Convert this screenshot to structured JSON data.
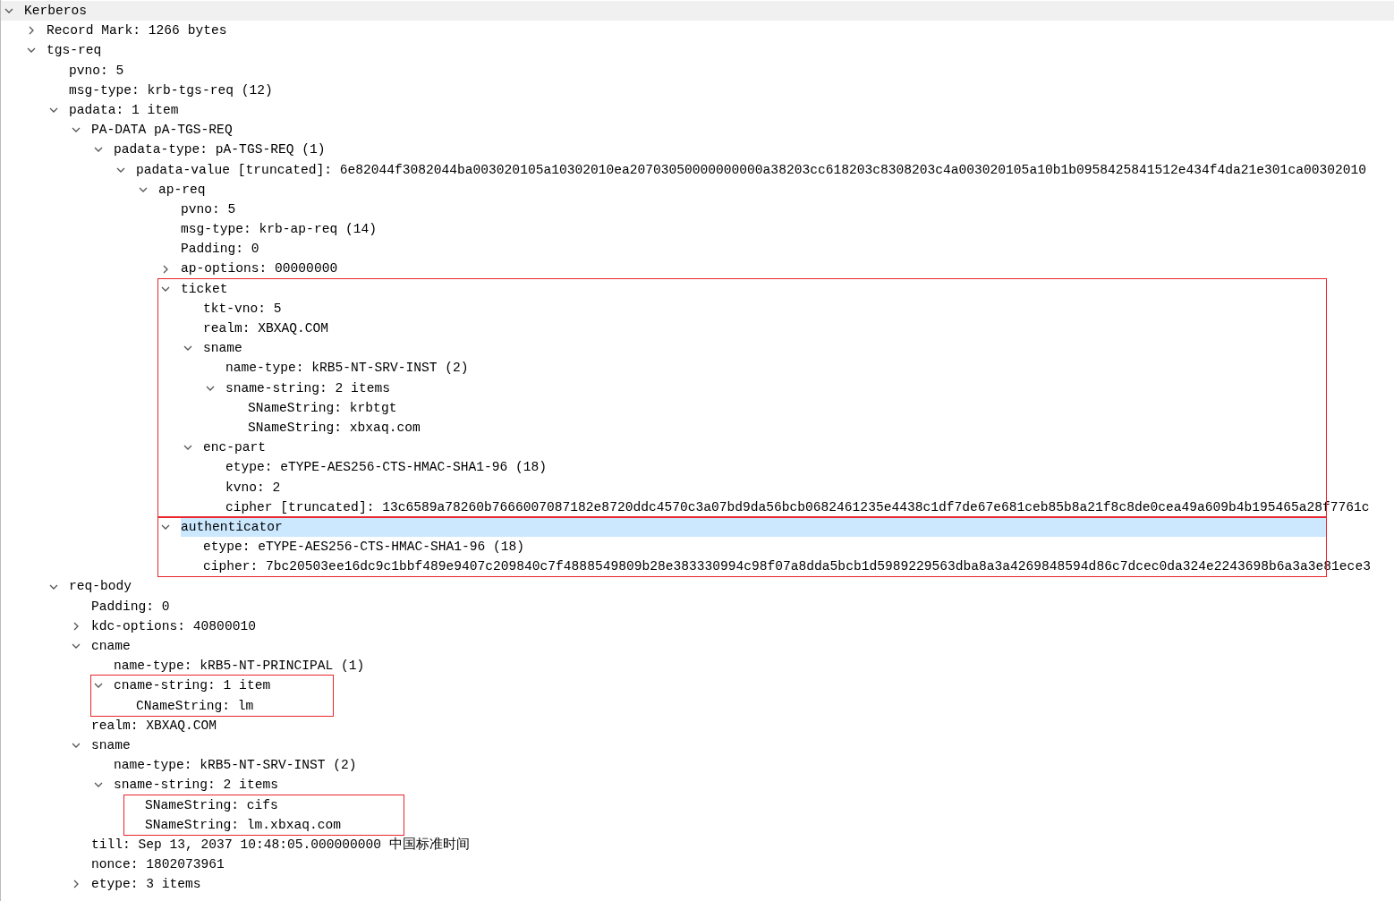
{
  "tree": [
    {
      "label": "Kerberos",
      "expanded": true,
      "selected": false,
      "children": [
        {
          "label": "Record Mark: 1266 bytes",
          "expanded": false,
          "selected": false
        },
        {
          "label": "tgs-req",
          "expanded": true,
          "selected": false,
          "children": [
            {
              "label": "pvno: 5",
              "selected": false
            },
            {
              "label": "msg-type: krb-tgs-req (12)",
              "selected": false
            },
            {
              "label": "padata: 1 item",
              "expanded": true,
              "selected": false,
              "children": [
                {
                  "label": "PA-DATA pA-TGS-REQ",
                  "expanded": true,
                  "selected": false,
                  "children": [
                    {
                      "label": "padata-type: pA-TGS-REQ (1)",
                      "expanded": true,
                      "selected": false,
                      "children": [
                        {
                          "label": "padata-value [truncated]: 6e82044f3082044ba003020105a10302010ea20703050000000000a38203cc618203c8308203c4a003020105a10b1b0958425841512e434f4da21e301ca00302010",
                          "expanded": true,
                          "selected": false,
                          "children": [
                            {
                              "label": "ap-req",
                              "expanded": true,
                              "selected": false,
                              "children": [
                                {
                                  "label": "pvno: 5",
                                  "selected": false
                                },
                                {
                                  "label": "msg-type: krb-ap-req (14)",
                                  "selected": false
                                },
                                {
                                  "label": "Padding: 0",
                                  "selected": false
                                },
                                {
                                  "label": "ap-options: 00000000",
                                  "expanded": false,
                                  "selected": false
                                },
                                {
                                  "label": "ticket",
                                  "expanded": true,
                                  "selected": false,
                                  "annotated": true,
                                  "children": [
                                    {
                                      "label": "tkt-vno: 5",
                                      "selected": false
                                    },
                                    {
                                      "label": "realm: XBXAQ.COM",
                                      "selected": false
                                    },
                                    {
                                      "label": "sname",
                                      "expanded": true,
                                      "selected": false,
                                      "children": [
                                        {
                                          "label": "name-type: kRB5-NT-SRV-INST (2)",
                                          "selected": false
                                        },
                                        {
                                          "label": "sname-string: 2 items",
                                          "expanded": true,
                                          "selected": false,
                                          "children": [
                                            {
                                              "label": "SNameString: krbtgt",
                                              "selected": false
                                            },
                                            {
                                              "label": "SNameString: xbxaq.com",
                                              "selected": false
                                            }
                                          ]
                                        }
                                      ]
                                    },
                                    {
                                      "label": "enc-part",
                                      "expanded": true,
                                      "selected": false,
                                      "children": [
                                        {
                                          "label": "etype: eTYPE-AES256-CTS-HMAC-SHA1-96 (18)",
                                          "selected": false
                                        },
                                        {
                                          "label": "kvno: 2",
                                          "selected": false
                                        },
                                        {
                                          "label": "cipher [truncated]: 13c6589a78260b7666007087182e8720ddc4570c3a07bd9da56bcb0682461235e4438c1df7de67e681ceb85b8a21f8c8de0cea49a609b4b195465a28f7761c",
                                          "selected": false
                                        }
                                      ]
                                    }
                                  ]
                                },
                                {
                                  "label": "authenticator",
                                  "expanded": true,
                                  "selected": true,
                                  "annotated": true,
                                  "children": [
                                    {
                                      "label": "etype: eTYPE-AES256-CTS-HMAC-SHA1-96 (18)",
                                      "selected": false
                                    },
                                    {
                                      "label": "cipher: 7bc20503ee16dc9c1bbf489e9407c209840c7f4888549809b28e383330994c98f07a8dda5bcb1d5989229563dba8a3a4269848594d86c7dcec0da324e2243698b6a3a3e81ece3",
                                      "selected": false
                                    }
                                  ]
                                }
                              ]
                            }
                          ]
                        }
                      ]
                    }
                  ]
                }
              ]
            },
            {
              "label": "req-body",
              "expanded": true,
              "selected": false,
              "children": [
                {
                  "label": "Padding: 0",
                  "selected": false
                },
                {
                  "label": "kdc-options: 40800010",
                  "expanded": false,
                  "selected": false
                },
                {
                  "label": "cname",
                  "expanded": true,
                  "selected": false,
                  "children": [
                    {
                      "label": "name-type: kRB5-NT-PRINCIPAL (1)",
                      "selected": false
                    },
                    {
                      "label": "cname-string: 1 item",
                      "expanded": true,
                      "selected": false,
                      "annotated": true,
                      "children": [
                        {
                          "label": "CNameString: lm",
                          "selected": false
                        }
                      ]
                    }
                  ]
                },
                {
                  "label": "realm: XBXAQ.COM",
                  "selected": false
                },
                {
                  "label": "sname",
                  "expanded": true,
                  "selected": false,
                  "children": [
                    {
                      "label": "name-type: kRB5-NT-SRV-INST (2)",
                      "selected": false
                    },
                    {
                      "label": "sname-string: 2 items",
                      "expanded": true,
                      "selected": false,
                      "children_annotated": true,
                      "children": [
                        {
                          "label": "SNameString: cifs",
                          "selected": false
                        },
                        {
                          "label": "SNameString: lm.xbxaq.com",
                          "selected": false
                        }
                      ]
                    }
                  ]
                },
                {
                  "label": "till: Sep 13, 2037 10:48:05.000000000 中国标准时间",
                  "selected": false
                },
                {
                  "label": "nonce: 1802073961",
                  "selected": false
                },
                {
                  "label": "etype: 3 items",
                  "expanded": false,
                  "selected": false
                }
              ]
            }
          ]
        }
      ]
    }
  ]
}
